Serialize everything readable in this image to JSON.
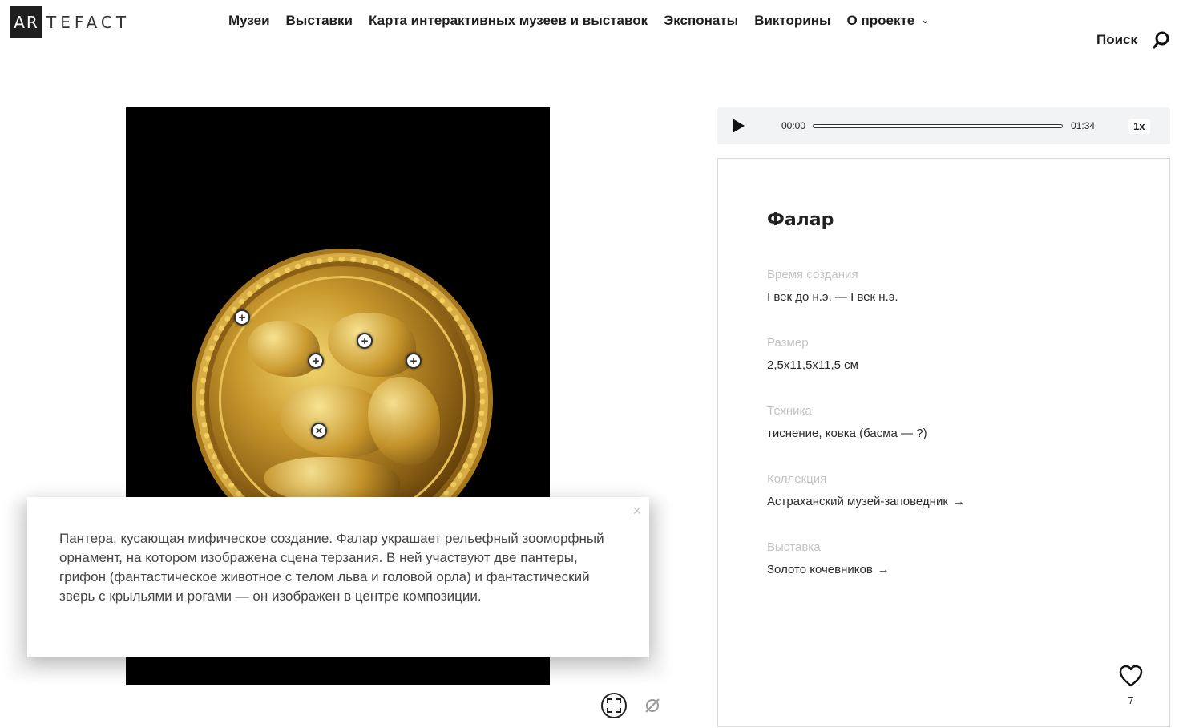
{
  "header": {
    "logo_box": "AR",
    "logo_rest": "TEFACT",
    "nav": [
      {
        "label": "Музеи"
      },
      {
        "label": "Выставки"
      },
      {
        "label": "Карта интерактивных музеев и выставок"
      },
      {
        "label": "Экспонаты"
      },
      {
        "label": "Викторины"
      },
      {
        "label": "О проекте"
      }
    ],
    "search_label": "Поиск"
  },
  "audio": {
    "current_time": "00:00",
    "duration": "01:34",
    "speed": "1x",
    "progress": 0
  },
  "popup": {
    "text": "Пантера, кусающая мифическое создание. Фалар украшает рельефный зооморфный орнамент, на котором изображена сцена терзания. В ней участвуют две пантеры, грифон (фантастическое животное с телом льва и головой орла) и фантастический зверь с крыльями и рогами — он изображен в центре композиции.",
    "close_symbol": "×"
  },
  "artifact": {
    "title": "Фалар",
    "fields": [
      {
        "label": "Время создания",
        "value": "I век до н.э. — I век н.э."
      },
      {
        "label": "Размер",
        "value": "2,5x11,5x11,5 см"
      },
      {
        "label": "Техника",
        "value": "тиснение, ковка (басма — ?)"
      },
      {
        "label": "Коллекция",
        "value": "Астраханский музей-заповедник",
        "arrow": "→"
      },
      {
        "label": "Выставка",
        "value": "Золото кочевников",
        "arrow": "→"
      }
    ],
    "likes": "7"
  },
  "hotspots": [
    {
      "symbol": "+"
    },
    {
      "symbol": "+"
    },
    {
      "symbol": "+"
    },
    {
      "symbol": "+"
    },
    {
      "symbol": "×"
    }
  ]
}
